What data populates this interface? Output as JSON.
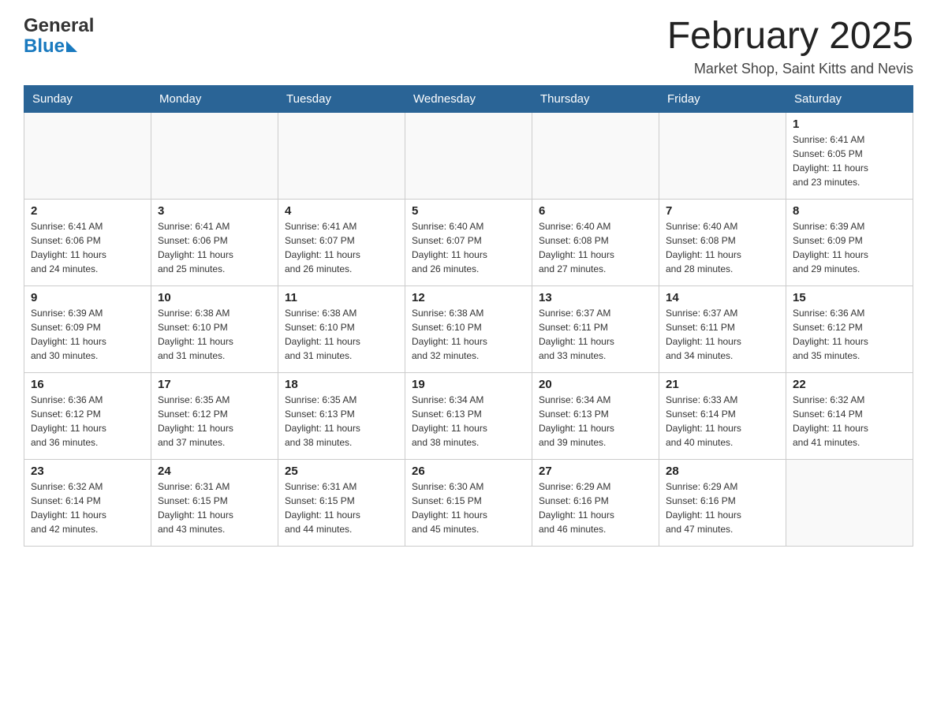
{
  "header": {
    "logo": {
      "general": "General",
      "blue": "Blue",
      "arrow": "▶"
    },
    "title": "February 2025",
    "subtitle": "Market Shop, Saint Kitts and Nevis"
  },
  "calendar": {
    "headers": [
      "Sunday",
      "Monday",
      "Tuesday",
      "Wednesday",
      "Thursday",
      "Friday",
      "Saturday"
    ],
    "weeks": [
      [
        {
          "day": "",
          "info": ""
        },
        {
          "day": "",
          "info": ""
        },
        {
          "day": "",
          "info": ""
        },
        {
          "day": "",
          "info": ""
        },
        {
          "day": "",
          "info": ""
        },
        {
          "day": "",
          "info": ""
        },
        {
          "day": "1",
          "info": "Sunrise: 6:41 AM\nSunset: 6:05 PM\nDaylight: 11 hours\nand 23 minutes."
        }
      ],
      [
        {
          "day": "2",
          "info": "Sunrise: 6:41 AM\nSunset: 6:06 PM\nDaylight: 11 hours\nand 24 minutes."
        },
        {
          "day": "3",
          "info": "Sunrise: 6:41 AM\nSunset: 6:06 PM\nDaylight: 11 hours\nand 25 minutes."
        },
        {
          "day": "4",
          "info": "Sunrise: 6:41 AM\nSunset: 6:07 PM\nDaylight: 11 hours\nand 26 minutes."
        },
        {
          "day": "5",
          "info": "Sunrise: 6:40 AM\nSunset: 6:07 PM\nDaylight: 11 hours\nand 26 minutes."
        },
        {
          "day": "6",
          "info": "Sunrise: 6:40 AM\nSunset: 6:08 PM\nDaylight: 11 hours\nand 27 minutes."
        },
        {
          "day": "7",
          "info": "Sunrise: 6:40 AM\nSunset: 6:08 PM\nDaylight: 11 hours\nand 28 minutes."
        },
        {
          "day": "8",
          "info": "Sunrise: 6:39 AM\nSunset: 6:09 PM\nDaylight: 11 hours\nand 29 minutes."
        }
      ],
      [
        {
          "day": "9",
          "info": "Sunrise: 6:39 AM\nSunset: 6:09 PM\nDaylight: 11 hours\nand 30 minutes."
        },
        {
          "day": "10",
          "info": "Sunrise: 6:38 AM\nSunset: 6:10 PM\nDaylight: 11 hours\nand 31 minutes."
        },
        {
          "day": "11",
          "info": "Sunrise: 6:38 AM\nSunset: 6:10 PM\nDaylight: 11 hours\nand 31 minutes."
        },
        {
          "day": "12",
          "info": "Sunrise: 6:38 AM\nSunset: 6:10 PM\nDaylight: 11 hours\nand 32 minutes."
        },
        {
          "day": "13",
          "info": "Sunrise: 6:37 AM\nSunset: 6:11 PM\nDaylight: 11 hours\nand 33 minutes."
        },
        {
          "day": "14",
          "info": "Sunrise: 6:37 AM\nSunset: 6:11 PM\nDaylight: 11 hours\nand 34 minutes."
        },
        {
          "day": "15",
          "info": "Sunrise: 6:36 AM\nSunset: 6:12 PM\nDaylight: 11 hours\nand 35 minutes."
        }
      ],
      [
        {
          "day": "16",
          "info": "Sunrise: 6:36 AM\nSunset: 6:12 PM\nDaylight: 11 hours\nand 36 minutes."
        },
        {
          "day": "17",
          "info": "Sunrise: 6:35 AM\nSunset: 6:12 PM\nDaylight: 11 hours\nand 37 minutes."
        },
        {
          "day": "18",
          "info": "Sunrise: 6:35 AM\nSunset: 6:13 PM\nDaylight: 11 hours\nand 38 minutes."
        },
        {
          "day": "19",
          "info": "Sunrise: 6:34 AM\nSunset: 6:13 PM\nDaylight: 11 hours\nand 38 minutes."
        },
        {
          "day": "20",
          "info": "Sunrise: 6:34 AM\nSunset: 6:13 PM\nDaylight: 11 hours\nand 39 minutes."
        },
        {
          "day": "21",
          "info": "Sunrise: 6:33 AM\nSunset: 6:14 PM\nDaylight: 11 hours\nand 40 minutes."
        },
        {
          "day": "22",
          "info": "Sunrise: 6:32 AM\nSunset: 6:14 PM\nDaylight: 11 hours\nand 41 minutes."
        }
      ],
      [
        {
          "day": "23",
          "info": "Sunrise: 6:32 AM\nSunset: 6:14 PM\nDaylight: 11 hours\nand 42 minutes."
        },
        {
          "day": "24",
          "info": "Sunrise: 6:31 AM\nSunset: 6:15 PM\nDaylight: 11 hours\nand 43 minutes."
        },
        {
          "day": "25",
          "info": "Sunrise: 6:31 AM\nSunset: 6:15 PM\nDaylight: 11 hours\nand 44 minutes."
        },
        {
          "day": "26",
          "info": "Sunrise: 6:30 AM\nSunset: 6:15 PM\nDaylight: 11 hours\nand 45 minutes."
        },
        {
          "day": "27",
          "info": "Sunrise: 6:29 AM\nSunset: 6:16 PM\nDaylight: 11 hours\nand 46 minutes."
        },
        {
          "day": "28",
          "info": "Sunrise: 6:29 AM\nSunset: 6:16 PM\nDaylight: 11 hours\nand 47 minutes."
        },
        {
          "day": "",
          "info": ""
        }
      ]
    ]
  }
}
